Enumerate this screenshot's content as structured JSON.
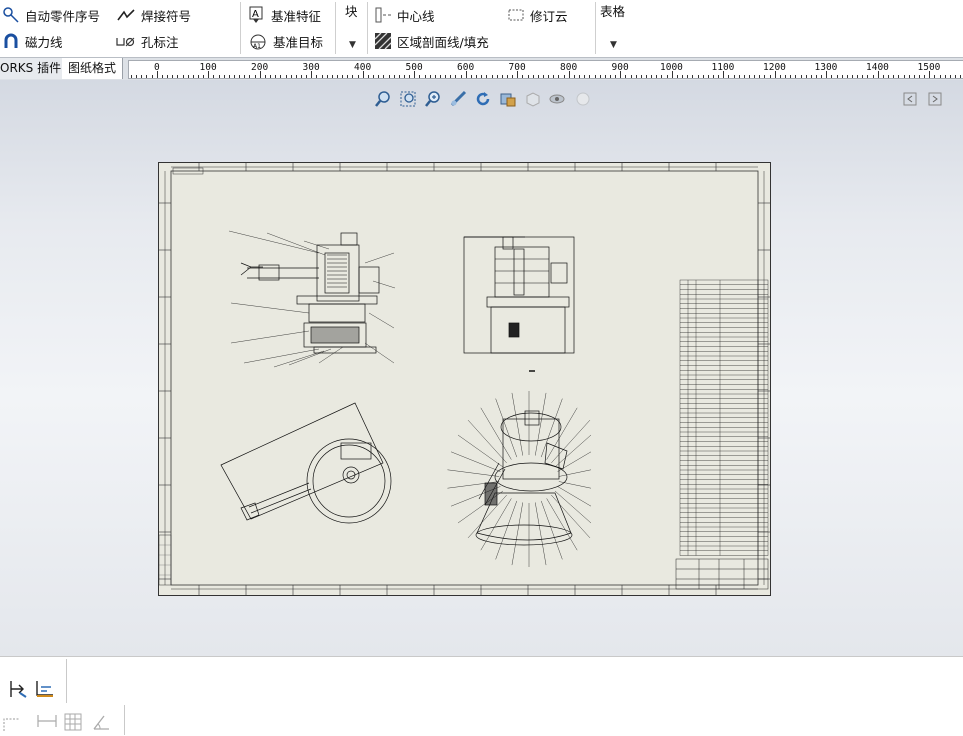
{
  "ribbon": {
    "auto_balloon": "自动零件序号",
    "weld_symbol": "焊接符号",
    "magnetic_line": "磁力线",
    "hole_callout": "孔标注",
    "datum_feature": "基准特征",
    "datum_target": "基准目标",
    "block": "块",
    "centerline": "中心线",
    "revision_cloud": "修订云",
    "area_hatch": "区域剖面线/填充",
    "tables": "表格"
  },
  "tabs": [
    {
      "label": "ORKS 插件"
    },
    {
      "label": "图纸格式"
    }
  ],
  "ruler": {
    "labels": [
      "0",
      "100",
      "200",
      "300",
      "400",
      "500",
      "600",
      "700",
      "800",
      "900",
      "1000",
      "1100",
      "1200",
      "1300",
      "1400",
      "1500"
    ]
  },
  "hud_icons": [
    "zoom-to-fit-icon",
    "zoom-to-area-icon",
    "zoom-in-out-icon",
    "pan-icon",
    "rotate-icon",
    "display-style-icon",
    "view-orientation-icon",
    "hide-show-icon",
    "appearance-icon"
  ],
  "bottom_icons": [
    "smart-dimension-icon",
    "baseline-dimension-icon",
    "path-dimension-icon",
    "table-icon",
    "angle-icon"
  ]
}
